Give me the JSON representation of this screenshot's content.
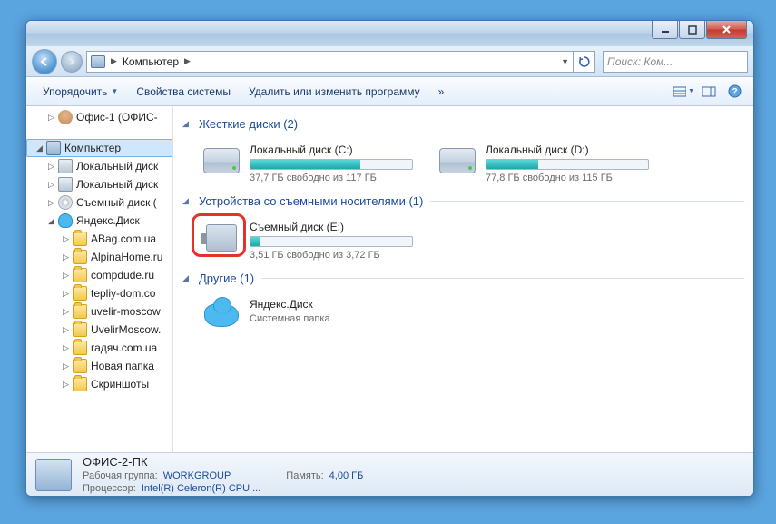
{
  "titlebar": {},
  "address": {
    "location": "Компьютер",
    "search_placeholder": "Поиск: Ком..."
  },
  "toolbar": {
    "organize": "Упорядочить",
    "system_props": "Свойства системы",
    "uninstall": "Удалить или изменить программу",
    "overflow": "»"
  },
  "sidebar": {
    "user": "Офис-1 (ОФИС-",
    "computer": "Компьютер",
    "local_disk": "Локальный диск",
    "removable": "Съемный диск (",
    "yandex": "Яндекс.Диск",
    "folders": [
      "ABag.com.ua",
      "AlpinaHome.ru",
      "compdude.ru",
      "tepliy-dom.co",
      "uvelir-moscow",
      "UvelirMoscow.",
      "гадяч.com.ua",
      "Новая папка",
      "Скриншоты"
    ]
  },
  "content": {
    "group_hdd": "Жесткие диски (2)",
    "group_removable": "Устройства со съемными носителями (1)",
    "group_other": "Другие (1)",
    "drives": {
      "c": {
        "name": "Локальный диск (C:)",
        "free": "37,7 ГБ свободно из 117 ГБ",
        "fill": 68
      },
      "d": {
        "name": "Локальный диск (D:)",
        "free": "77,8 ГБ свободно из 115 ГБ",
        "fill": 32
      },
      "e": {
        "name": "Съемный диск (E:)",
        "free": "3,51 ГБ свободно из 3,72 ГБ",
        "fill": 6
      }
    },
    "yandex": {
      "name": "Яндекс.Диск",
      "sub": "Системная папка"
    }
  },
  "status": {
    "pc_name": "ОФИС-2-ПК",
    "workgroup_label": "Рабочая группа:",
    "workgroup": "WORKGROUP",
    "cpu_label": "Процессор:",
    "cpu": "Intel(R) Celeron(R) CPU ...",
    "memory_label": "Память:",
    "memory": "4,00 ГБ"
  }
}
